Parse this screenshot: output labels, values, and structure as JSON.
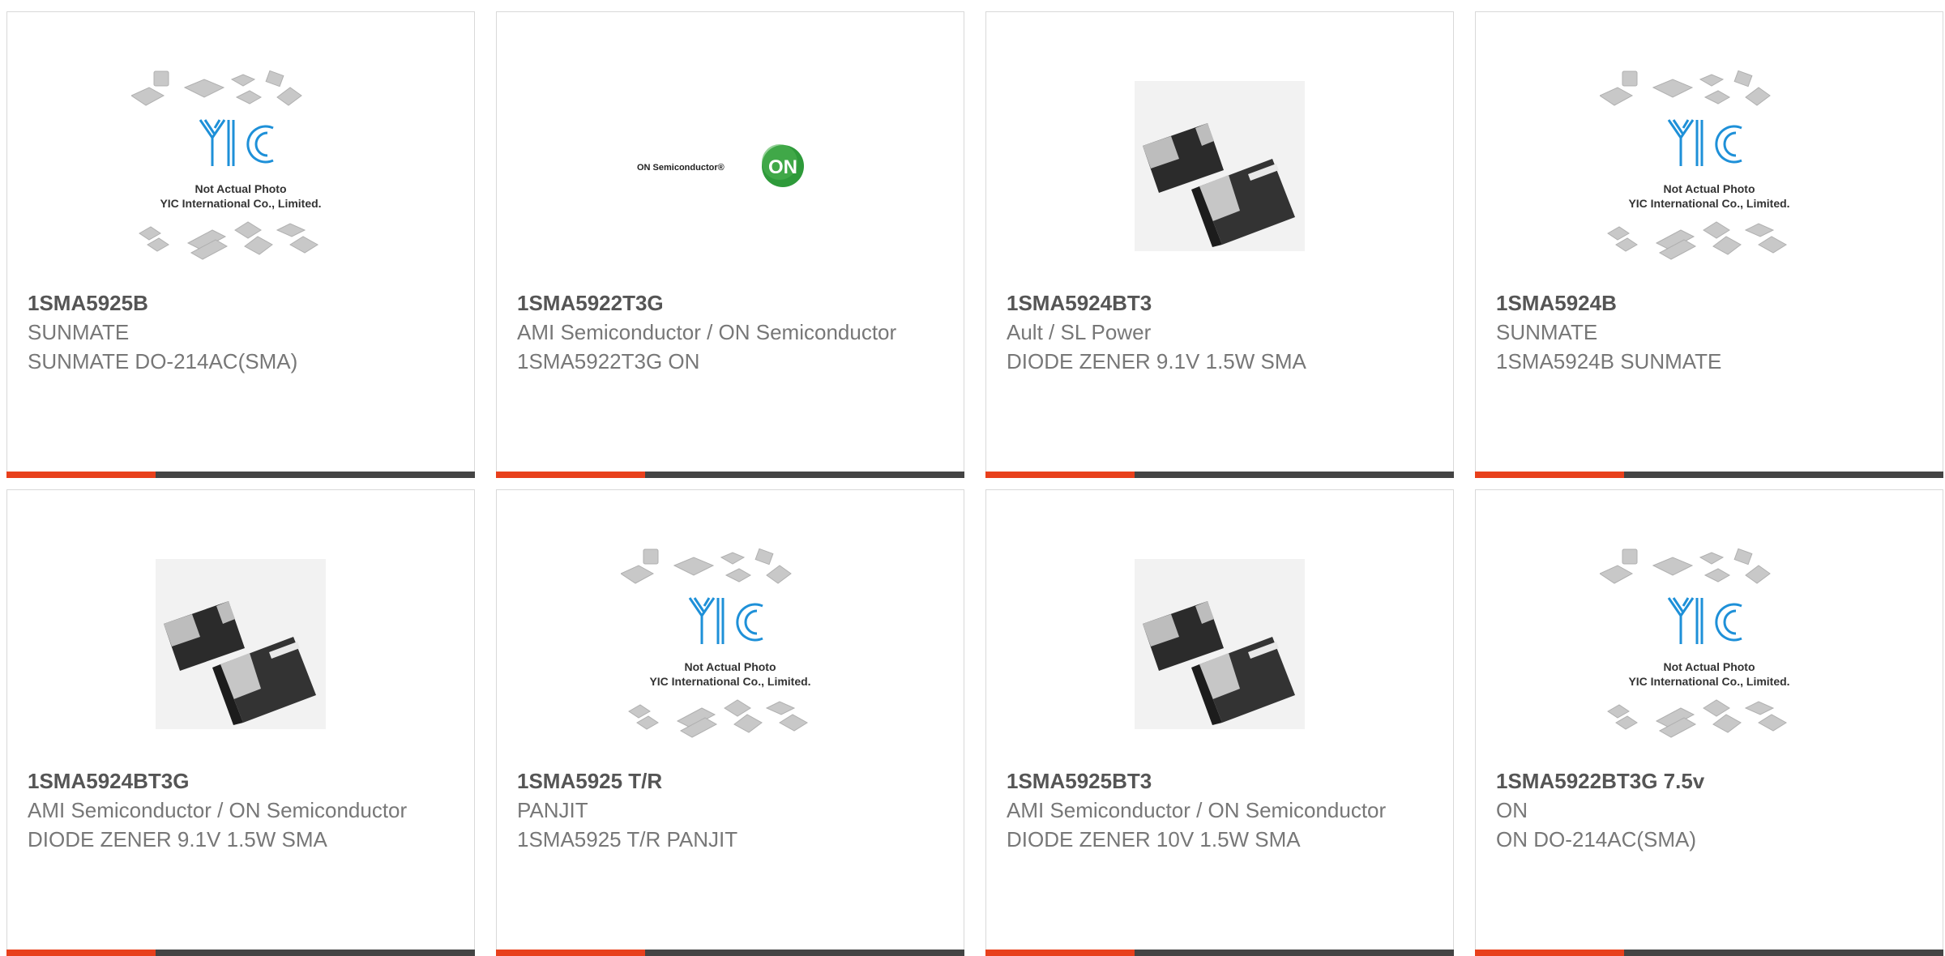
{
  "products": [
    {
      "part": "1SMA5925B",
      "maker": "SUNMATE",
      "desc": "SUNMATE DO-214AC(SMA)",
      "image": "yic-placeholder",
      "placeholder_text": "Not Actual Photo",
      "company_text": "YIC International Co., Limited.",
      "logo_text": "YIC"
    },
    {
      "part": "1SMA5922T3G",
      "maker": "AMI Semiconductor / ON Semiconductor",
      "desc": "1SMA5922T3G ON",
      "image": "on-semiconductor-logo",
      "logo_text": "ON Semiconductor®",
      "badge_text": "ON"
    },
    {
      "part": "1SMA5924BT3",
      "maker": "Ault / SL Power",
      "desc": "DIODE ZENER 9.1V 1.5W SMA",
      "image": "sma-diode-photo"
    },
    {
      "part": "1SMA5924B",
      "maker": "SUNMATE",
      "desc": "1SMA5924B SUNMATE",
      "image": "yic-placeholder",
      "placeholder_text": "Not Actual Photo",
      "company_text": "YIC International Co., Limited.",
      "logo_text": "YIC"
    },
    {
      "part": "1SMA5924BT3G",
      "maker": "AMI Semiconductor / ON Semiconductor",
      "desc": "DIODE ZENER 9.1V 1.5W SMA",
      "image": "sma-diode-photo"
    },
    {
      "part": "1SMA5925 T/R",
      "maker": "PANJIT",
      "desc": "1SMA5925 T/R PANJIT",
      "image": "yic-placeholder",
      "placeholder_text": "Not Actual Photo",
      "company_text": "YIC International Co., Limited.",
      "logo_text": "YIC"
    },
    {
      "part": "1SMA5925BT3",
      "maker": "AMI Semiconductor / ON Semiconductor",
      "desc": "DIODE ZENER 10V 1.5W SMA",
      "image": "sma-diode-photo"
    },
    {
      "part": "1SMA5922BT3G 7.5v",
      "maker": "ON",
      "desc": "ON DO-214AC(SMA)",
      "image": "yic-placeholder",
      "placeholder_text": "Not Actual Photo",
      "company_text": "YIC International Co., Limited.",
      "logo_text": "YIC"
    }
  ],
  "colors": {
    "accent": "#e8401c",
    "bar_dark": "#444444",
    "border": "#d9d9d9",
    "text": "#777777",
    "title": "#555555",
    "yic_blue": "#1e90d8",
    "on_green": "#2e9a3a"
  }
}
